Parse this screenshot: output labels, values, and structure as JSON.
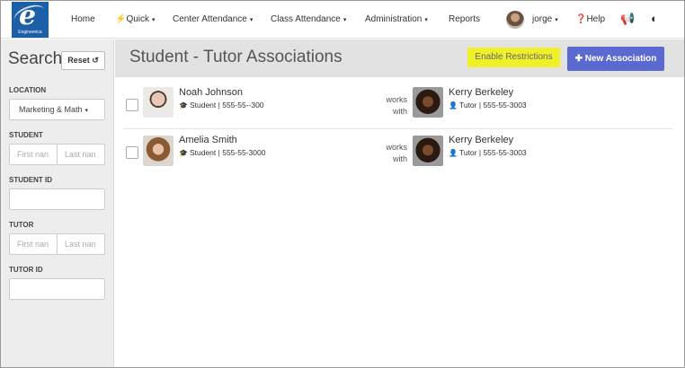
{
  "brand": {
    "logo_text": "Engineerica"
  },
  "nav": {
    "items": [
      {
        "label": "Home",
        "caret": ""
      },
      {
        "label": "Quick",
        "icon": "bolt-icon",
        "caret": "▾"
      },
      {
        "label": "Center Attendance",
        "caret": "▾"
      },
      {
        "label": "Class Attendance",
        "caret": "▾"
      },
      {
        "label": "Administration",
        "caret": "▾"
      },
      {
        "label": "Reports",
        "caret": ""
      }
    ],
    "user": "jorge",
    "help": "Help"
  },
  "sidebar": {
    "title": "Search",
    "reset_label": "Reset",
    "location_label": "LOCATION",
    "location_value": "Marketing & Math",
    "student_label": "STUDENT",
    "student_first_placeholder": "First nan",
    "student_last_placeholder": "Last nan",
    "student_id_label": "STUDENT ID",
    "tutor_label": "TUTOR",
    "tutor_first_placeholder": "First nan",
    "tutor_last_placeholder": "Last nan",
    "tutor_id_label": "TUTOR ID"
  },
  "main": {
    "title": "Student - Tutor Associations",
    "enable_restrictions_label": "Enable Restrictions",
    "new_association_label": "New Association",
    "works_label": "works",
    "with_label": "with",
    "associations": [
      {
        "student_name": "Noah Johnson",
        "student_role": "Student",
        "student_phone": "555-55--300",
        "tutor_name": "Kerry Berkeley",
        "tutor_role": "Tutor",
        "tutor_phone": "555-55-3003"
      },
      {
        "student_name": "Amelia Smith",
        "student_role": "Student",
        "student_phone": "555-55-3000",
        "tutor_name": "Kerry Berkeley",
        "tutor_role": "Tutor",
        "tutor_phone": "555-55-3003"
      }
    ]
  },
  "colors": {
    "primary": "#5b6ad0",
    "highlight": "#eef02a",
    "brand": "#1b5fa8"
  }
}
